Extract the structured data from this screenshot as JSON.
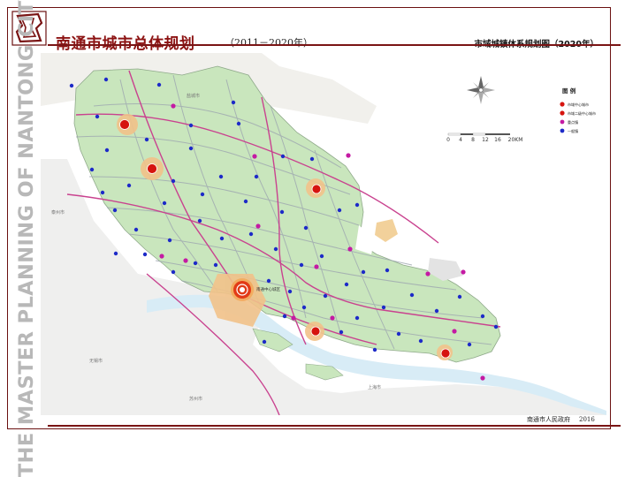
{
  "header": {
    "title": "南通市城市总体规划",
    "subtitle": "（2011－2020年）",
    "map_title": "市域城镇体系规划图（2020年）"
  },
  "side_text": "THE MASTER PLANNING OF NANTONG CITY",
  "footer": {
    "org": "南通市人民政府",
    "year": "2016"
  },
  "legend": {
    "title": "图 例",
    "items": [
      {
        "label": "市域中心城市",
        "color": "#d6140f"
      },
      {
        "label": "市域二级中心城市",
        "color": "#d6140f"
      },
      {
        "label": "重点镇",
        "color": "#c41aa3"
      },
      {
        "label": "一般镇",
        "color": "#1d2ac8"
      }
    ]
  },
  "scale": {
    "labels": [
      "0",
      "4",
      "8",
      "12",
      "16",
      "20KM"
    ]
  },
  "map_labels": {
    "yancheng": "盐城市",
    "taizhou": "泰州市",
    "wuxi": "无锡市",
    "suzhou": "苏州市",
    "shanghai": "上海市",
    "center": "南通中心城区"
  },
  "colors": {
    "frame": "#6b1111",
    "land": "#c9e6bd",
    "sea": "#ffffff",
    "river": "#a9d4ea",
    "road_major": "#c9428f",
    "road_minor": "#9ea7b0",
    "town_general": "#1d2ac8",
    "town_key": "#c41aa3",
    "city": "#d6140f"
  }
}
